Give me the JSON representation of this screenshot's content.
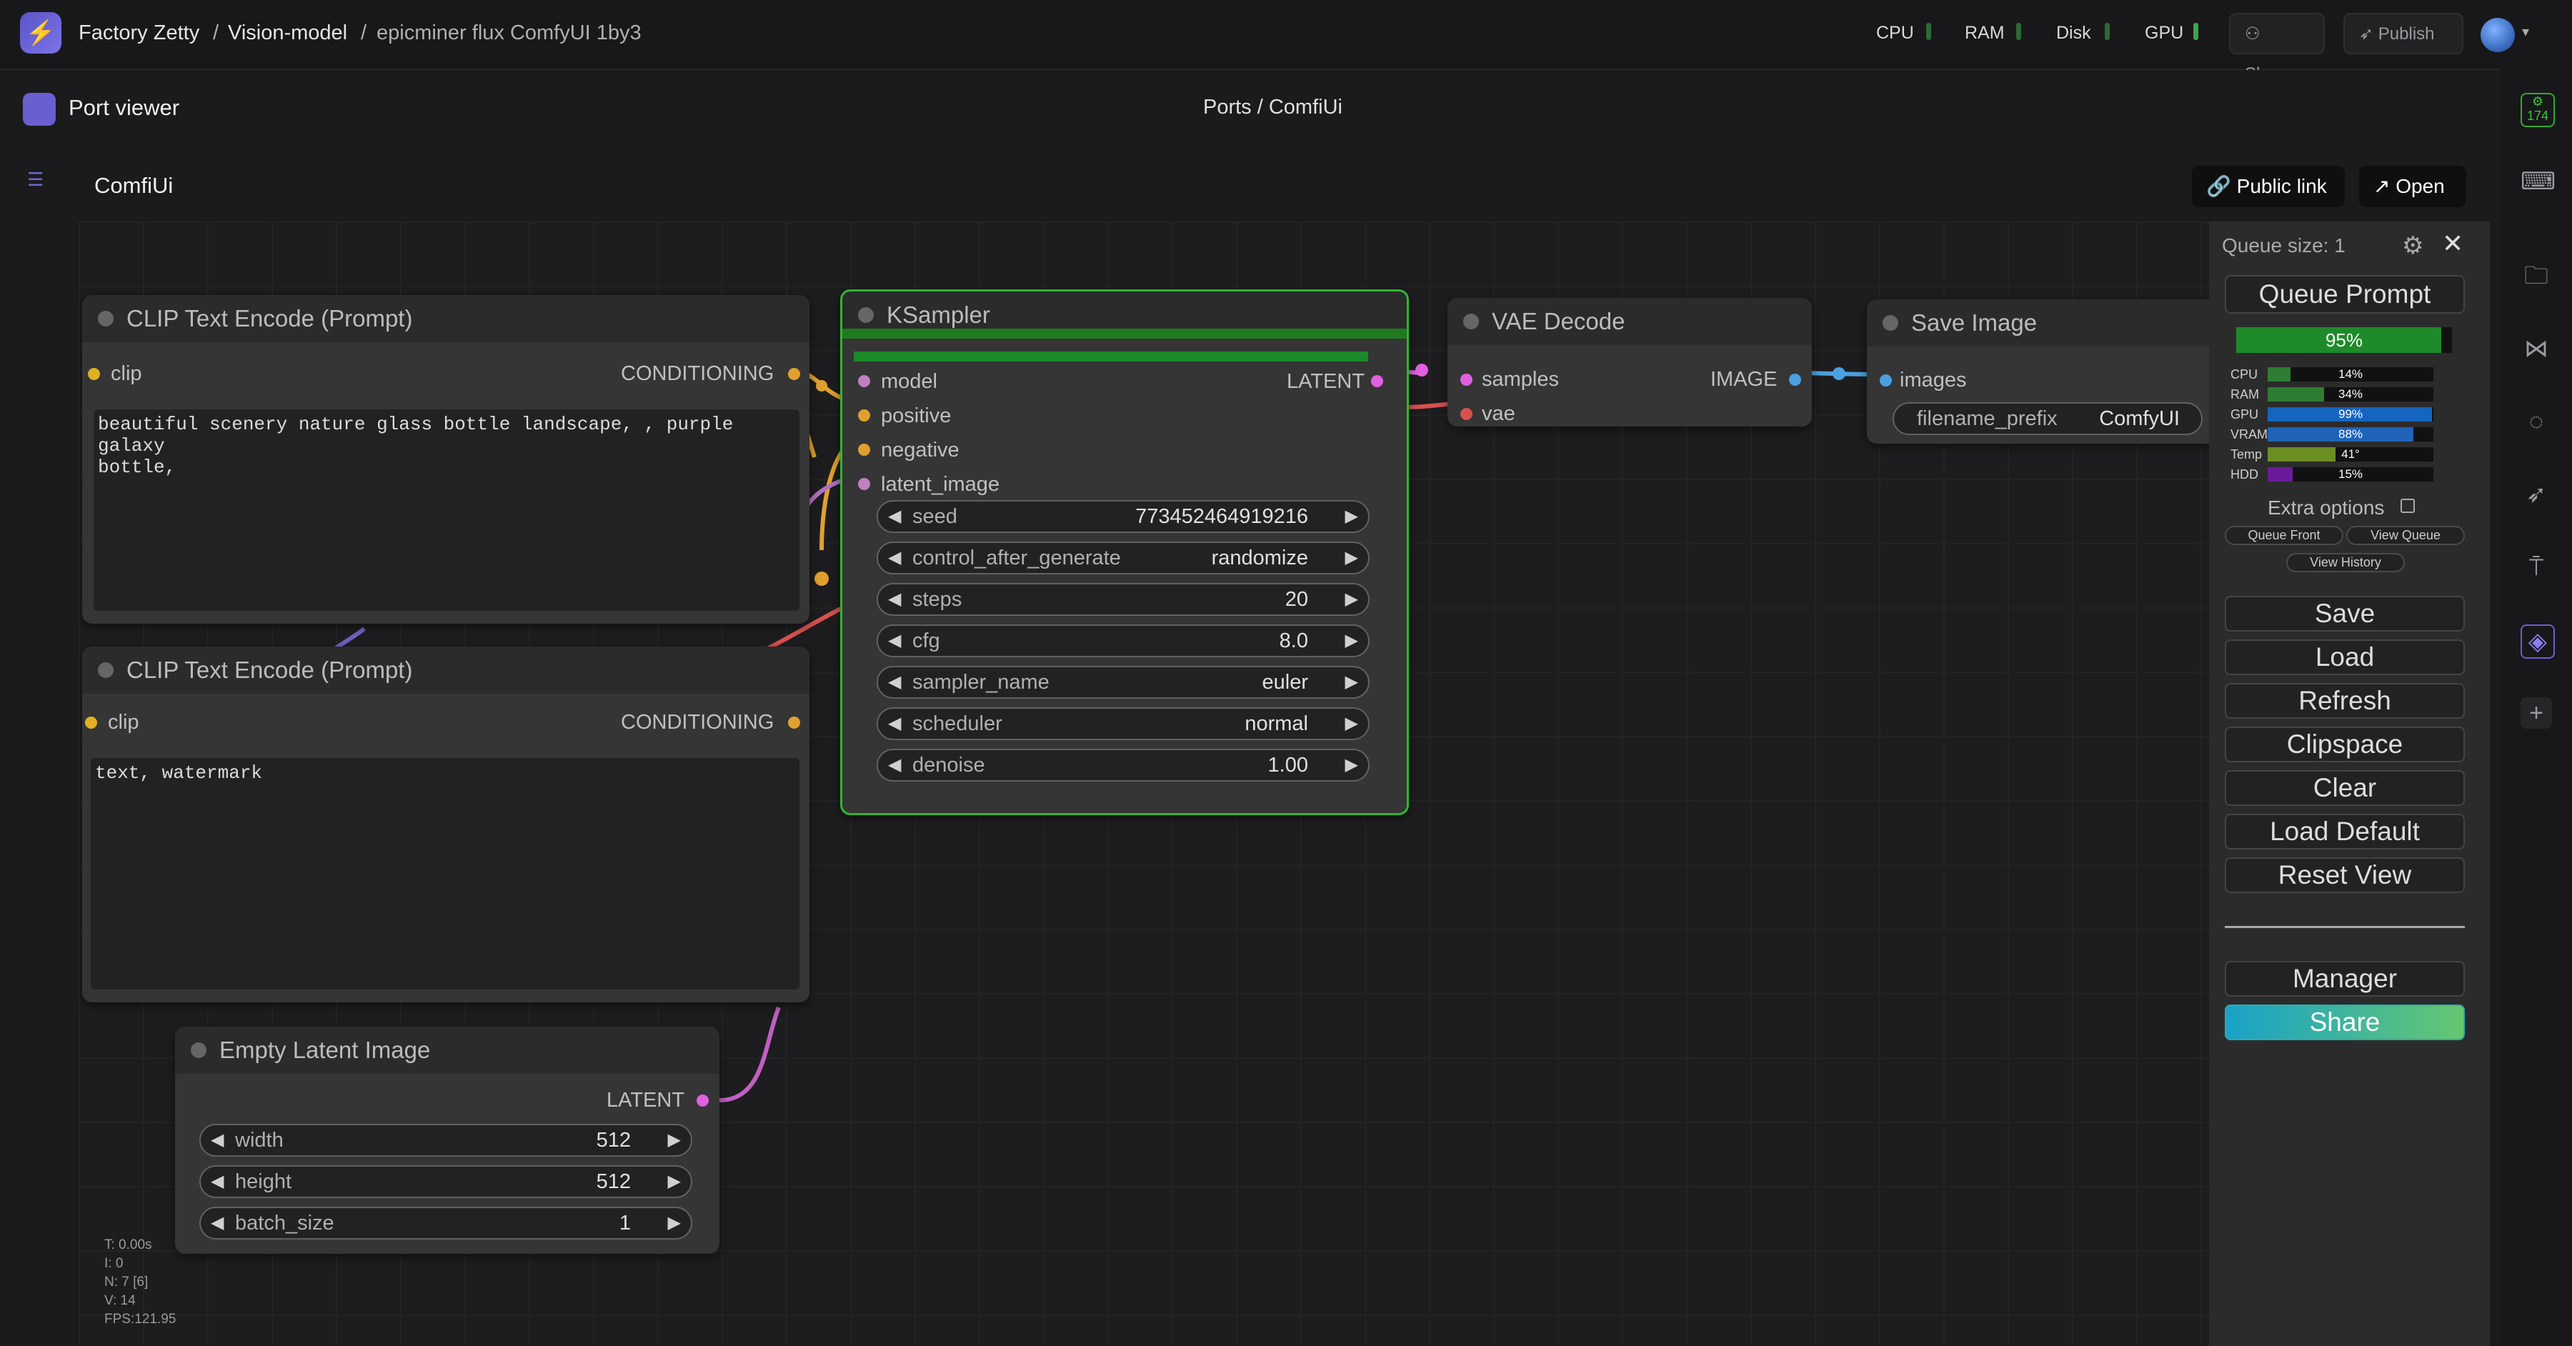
{
  "topbar": {
    "workspace": "Factory Zetty",
    "project": "Vision-model",
    "environment": "epicminer flux ComfyUI 1by3",
    "metrics": [
      "CPU",
      "RAM",
      "Disk",
      "GPU"
    ],
    "share_label": "Share",
    "publish_label": "Publish"
  },
  "subheader": {
    "title": "Port viewer",
    "breadcrumb": "Ports / ComfiUi",
    "app_title": "ComfiUi",
    "public_link_label": "Public link",
    "open_label": "Open"
  },
  "nodes": {
    "clip1": {
      "title": "CLIP Text Encode (Prompt)",
      "input": "clip",
      "output": "CONDITIONING",
      "text": "beautiful scenery nature glass bottle landscape, , purple galaxy\nbottle,"
    },
    "clip2": {
      "title": "CLIP Text Encode (Prompt)",
      "input": "clip",
      "output": "CONDITIONING",
      "text": "text, watermark"
    },
    "ksampler": {
      "title": "KSampler",
      "inputs": [
        "model",
        "positive",
        "negative",
        "latent_image"
      ],
      "output": "LATENT",
      "widgets": [
        {
          "name": "seed",
          "value": "773452464919216"
        },
        {
          "name": "control_after_generate",
          "value": "randomize"
        },
        {
          "name": "steps",
          "value": "20"
        },
        {
          "name": "cfg",
          "value": "8.0"
        },
        {
          "name": "sampler_name",
          "value": "euler"
        },
        {
          "name": "scheduler",
          "value": "normal"
        },
        {
          "name": "denoise",
          "value": "1.00"
        }
      ]
    },
    "vae": {
      "title": "VAE Decode",
      "inputs": [
        "samples",
        "vae"
      ],
      "output": "IMAGE"
    },
    "save": {
      "title": "Save Image",
      "input": "images",
      "widget": {
        "name": "filename_prefix",
        "value": "ComfyUI"
      }
    },
    "latent": {
      "title": "Empty Latent Image",
      "output": "LATENT",
      "widgets": [
        {
          "name": "width",
          "value": "512"
        },
        {
          "name": "height",
          "value": "512"
        },
        {
          "name": "batch_size",
          "value": "1"
        }
      ]
    }
  },
  "panel": {
    "queue_size": "Queue size: 1",
    "queue_prompt": "Queue Prompt",
    "progress": {
      "label": "95%",
      "value": 0.95
    },
    "monitors": [
      {
        "label": "CPU",
        "value": "14%",
        "fraction": 0.14,
        "color": "#2e7d32"
      },
      {
        "label": "RAM",
        "value": "34%",
        "fraction": 0.34,
        "color": "#2e7d32"
      },
      {
        "label": "GPU",
        "value": "99%",
        "fraction": 0.99,
        "color": "#1565c0"
      },
      {
        "label": "VRAM",
        "value": "88%",
        "fraction": 0.88,
        "color": "#1e63b8"
      },
      {
        "label": "Temp",
        "value": "41°",
        "fraction": 0.41,
        "color": "#6b8e23"
      },
      {
        "label": "HDD",
        "value": "15%",
        "fraction": 0.15,
        "color": "#6a1b9a"
      }
    ],
    "extra_options": "Extra options",
    "queue_front": "Queue Front",
    "view_queue": "View Queue",
    "view_history": "View History",
    "buttons": [
      "Save",
      "Load",
      "Refresh",
      "Clipspace",
      "Clear",
      "Load Default",
      "Reset View"
    ],
    "manager": "Manager",
    "share": "Share"
  },
  "stats": [
    "T: 0.00s",
    "I: 0",
    "N: 7 [6]",
    "V: 14",
    "FPS:121.95"
  ],
  "rail": {
    "badge": "174"
  }
}
